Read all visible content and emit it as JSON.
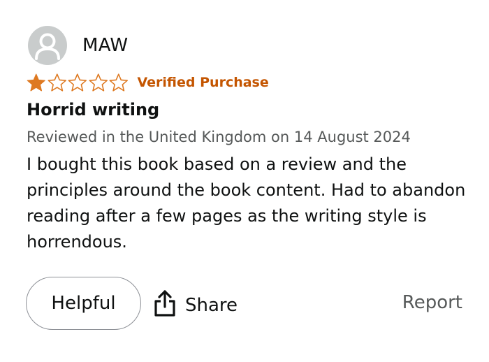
{
  "reviewer": {
    "name": "MAW",
    "avatar_icon": "person-silhouette-icon"
  },
  "rating": {
    "value": 1,
    "max": 5,
    "filled_color": "#de7921",
    "empty_color": "#de7921",
    "verified_label": "Verified Purchase",
    "verified_color": "#c45500"
  },
  "review": {
    "title": "Horrid writing",
    "meta": "Reviewed in the United Kingdom on 14 August 2024",
    "body": "I bought this book based on a review and the principles around the book content. Had to abandon reading after a few pages as the writing style is horrendous."
  },
  "actions": {
    "helpful_label": "Helpful",
    "share_label": "Share",
    "share_icon": "share-icon",
    "report_label": "Report"
  }
}
